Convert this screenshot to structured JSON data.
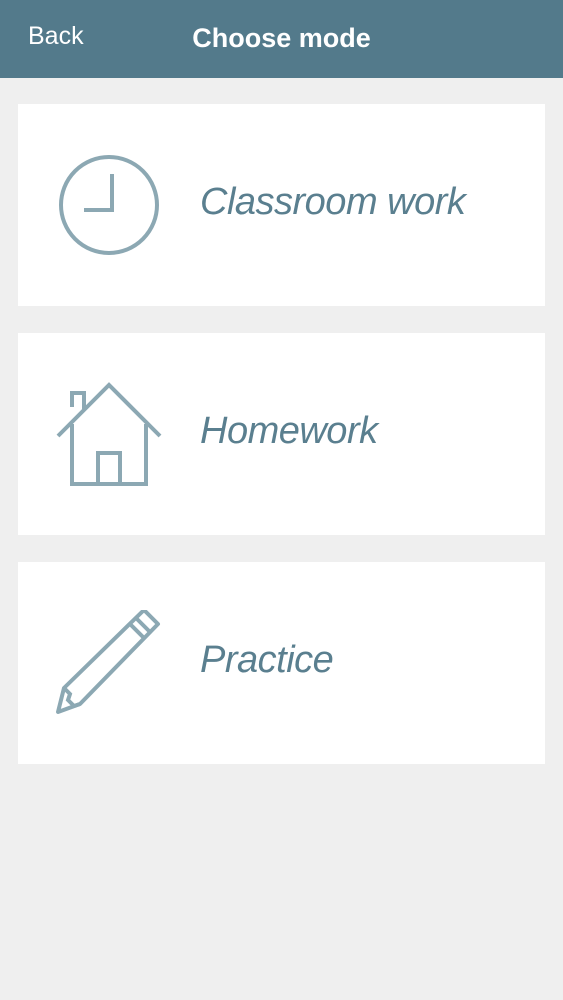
{
  "header": {
    "back_label": "Back",
    "title": "Choose mode",
    "background_color": "#537a8b"
  },
  "modes": [
    {
      "label": "Classroom work",
      "icon": "clock-icon"
    },
    {
      "label": "Homework",
      "icon": "house-icon"
    },
    {
      "label": "Practice",
      "icon": "pencil-icon"
    }
  ],
  "colors": {
    "accent": "#537a8b",
    "icon_stroke": "#8ca8b3",
    "label_text": "#5a7f8f",
    "background": "#efefef"
  }
}
